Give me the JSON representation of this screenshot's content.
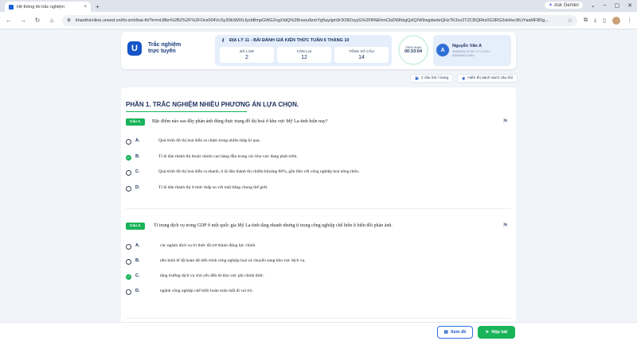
{
  "browser": {
    "tab_title": "Hệ thống thi trắc nghiệm",
    "tab_close": "×",
    "new_tab": "+",
    "gemini_label": "Ask Gemini",
    "url": "khaothionline.uneed.vn/thi-sinh/bai-thi?k=mU8bn%2BZ%2F%2FOvx004VcSy30bSMXLfyzbBmpGWG2ngXIdQ%2Brwou9zmYg5ay/gm9r3O8ZoyyG%2FBNEhmCbZN9hkgQzlQ/W9wgdwdeQHzTK3vz2TZCBQRkx0G3RG3xkHvc9lLtYaaMF8Dg..."
  },
  "header": {
    "brand_logo": "U",
    "brand_line1": "Trắc nghiệm",
    "brand_line2": "trực tuyến",
    "exam_title": "ĐỊA LÝ 11 - BÀI ĐÁNH GIÁ KIẾN THỨC TUẦN 6 THÁNG 10",
    "stats": [
      {
        "label": "ĐÃ LÀM",
        "value": "2"
      },
      {
        "label": "CÒN LẠI",
        "value": "12"
      },
      {
        "label": "TỔNG SỐ CÂU",
        "value": "14"
      }
    ],
    "timer_label": "THỜI GIAN",
    "timer_value": "00:33:04",
    "user": {
      "initial": "A",
      "name": "Nguyễn Văn A",
      "id": "00584694-4C30-7171-9700-",
      "phone": "0000966271863"
    }
  },
  "toolbar": {
    "per_page": "1 câu hỏi / trang",
    "show_list": "Hiển thị danh sách câu hỏi"
  },
  "section_title": "PHẦN 1. TRẮC NGHIỆM NHIỀU PHƯƠNG ÁN LỰA CHỌN.",
  "questions": [
    {
      "badge": "Câu 1.",
      "text": "Đặc điểm nào sau đây phản ánh đúng thực trạng đô thị hoá ở khu vực Mỹ La-tinh hiện nay?",
      "options": [
        {
          "letter": "A.",
          "text": "Quá trình đô thị hoá diễn ra chậm trong nhiều thập kỉ qua.",
          "selected": false
        },
        {
          "letter": "B.",
          "text": "Tỉ lệ dân thành thị thuộc nhóm cao hàng đầu trong các khu vực đang phát triển.",
          "selected": true
        },
        {
          "letter": "C.",
          "text": "Quá trình đô thị hoá diễn ra nhanh, tỉ lệ dân thành thị chiếm khoảng 80%, gắn liền với công nghiệp hoá nông thôn.",
          "selected": false
        },
        {
          "letter": "D.",
          "text": "Tỉ lệ dân thành thị ở mức thấp so với mặt bằng chung thế giới.",
          "selected": false
        }
      ]
    },
    {
      "badge": "Câu 2.",
      "text": "Tỉ trọng dịch vụ trong GDP ở một quốc gia Mỹ La-tinh tăng nhanh nhưng tỉ trọng công nghiệp chế biến ít biến đổi phản ánh.",
      "options": [
        {
          "letter": "A.",
          "text": "các ngành dịch vụ tri thức đã trở thành động lực chính.",
          "selected": false
        },
        {
          "letter": "B.",
          "text": "nền kinh tế đã hoàn tất tiến trình công nghiệp hoá và chuyển sang khu vực dịch vụ.",
          "selected": false
        },
        {
          "letter": "C.",
          "text": "tăng trưởng dịch vụ chủ yếu đến từ khu vực phi chính thức.",
          "selected": true
        },
        {
          "letter": "D.",
          "text": "ngành công nghiệp chế biến hoàn toàn mất đi vai trò.",
          "selected": false
        }
      ]
    }
  ],
  "footer": {
    "review_label": "Xem đề",
    "submit_label": "Nộp bài"
  },
  "colors": {
    "accent": "#19b35a",
    "brand": "#1554c8",
    "header_box": "#e5eefb"
  }
}
